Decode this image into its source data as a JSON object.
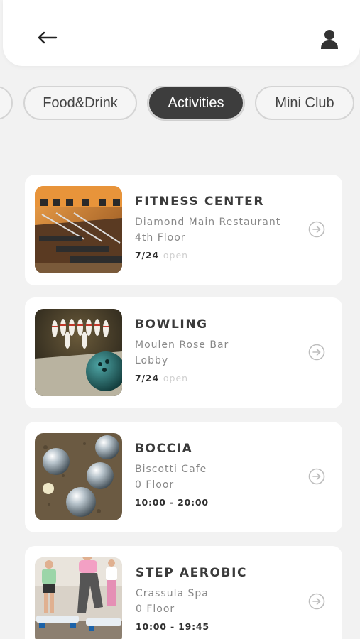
{
  "header": {
    "back_icon": "arrow-left-icon",
    "user_icon": "user-icon"
  },
  "tabs": [
    {
      "label": "",
      "partial": true
    },
    {
      "label": "Food&Drink",
      "active": false
    },
    {
      "label": "Activities",
      "active": true
    },
    {
      "label": "Mini Club",
      "active": false
    }
  ],
  "activities": [
    {
      "title": "FITNESS CENTER",
      "location": "Diamond Main Restaurant",
      "floor": "4th Floor",
      "hours": "7/24",
      "status": "open",
      "image": "gym-treadmills-image"
    },
    {
      "title": "BOWLING",
      "location": "Moulen Rose Bar",
      "floor": "Lobby",
      "hours": "7/24",
      "status": "open",
      "image": "bowling-pins-image"
    },
    {
      "title": "BOCCIA",
      "location": "Biscotti Cafe",
      "floor": "0 Floor",
      "hours": "10:00 - 20:00",
      "status": "",
      "image": "boccia-balls-image"
    },
    {
      "title": "STEP AEROBIC",
      "location": "Crassula Spa",
      "floor": "0 Floor",
      "hours": "10:00 - 19:45",
      "status": "",
      "image": "step-aerobic-image"
    }
  ],
  "colors": {
    "background": "#f2f2f2",
    "active_tab": "#3d3d3d",
    "card": "#ffffff"
  }
}
